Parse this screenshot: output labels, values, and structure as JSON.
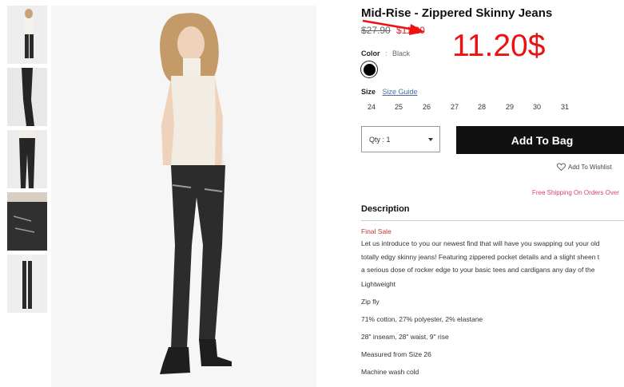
{
  "product": {
    "title": "Mid-Rise - Zippered Skinny Jeans",
    "old_price": "$27.90",
    "new_price": "$11.20",
    "price_annotation": "11.20$",
    "color_label": "Color",
    "color_sep": ":",
    "color_value": "Black",
    "swatch_color": "#000000",
    "size_label": "Size",
    "size_guide": "Size Guide",
    "sizes": [
      "24",
      "25",
      "26",
      "27",
      "28",
      "29",
      "30",
      "31"
    ],
    "qty_text": "Qty : 1",
    "add_to_bag": "Add To Bag",
    "wishlist": "Add To Wishlist",
    "shipping": "Free Shipping On Orders Over"
  },
  "description": {
    "heading": "Description",
    "final_sale": "Final Sale",
    "intro": [
      "Let us introduce to you our newest find that will have you swapping out your old",
      "totally edgy skinny jeans! Featuring zippered pocket details and a slight sheen t",
      "a serious dose of rocker edge to your basic tees and cardigans any day of the"
    ],
    "details": [
      "Lightweight",
      "Zip fly",
      "71% cotton, 27% polyester, 2% elastane",
      "28\" inseam, 28\" waist, 9\" rise",
      "Measured from Size 26",
      "Machine wash cold"
    ]
  },
  "colors": {
    "accent_red": "#ee1111",
    "button_black": "#111111",
    "shipping_pink": "#d4456a"
  }
}
